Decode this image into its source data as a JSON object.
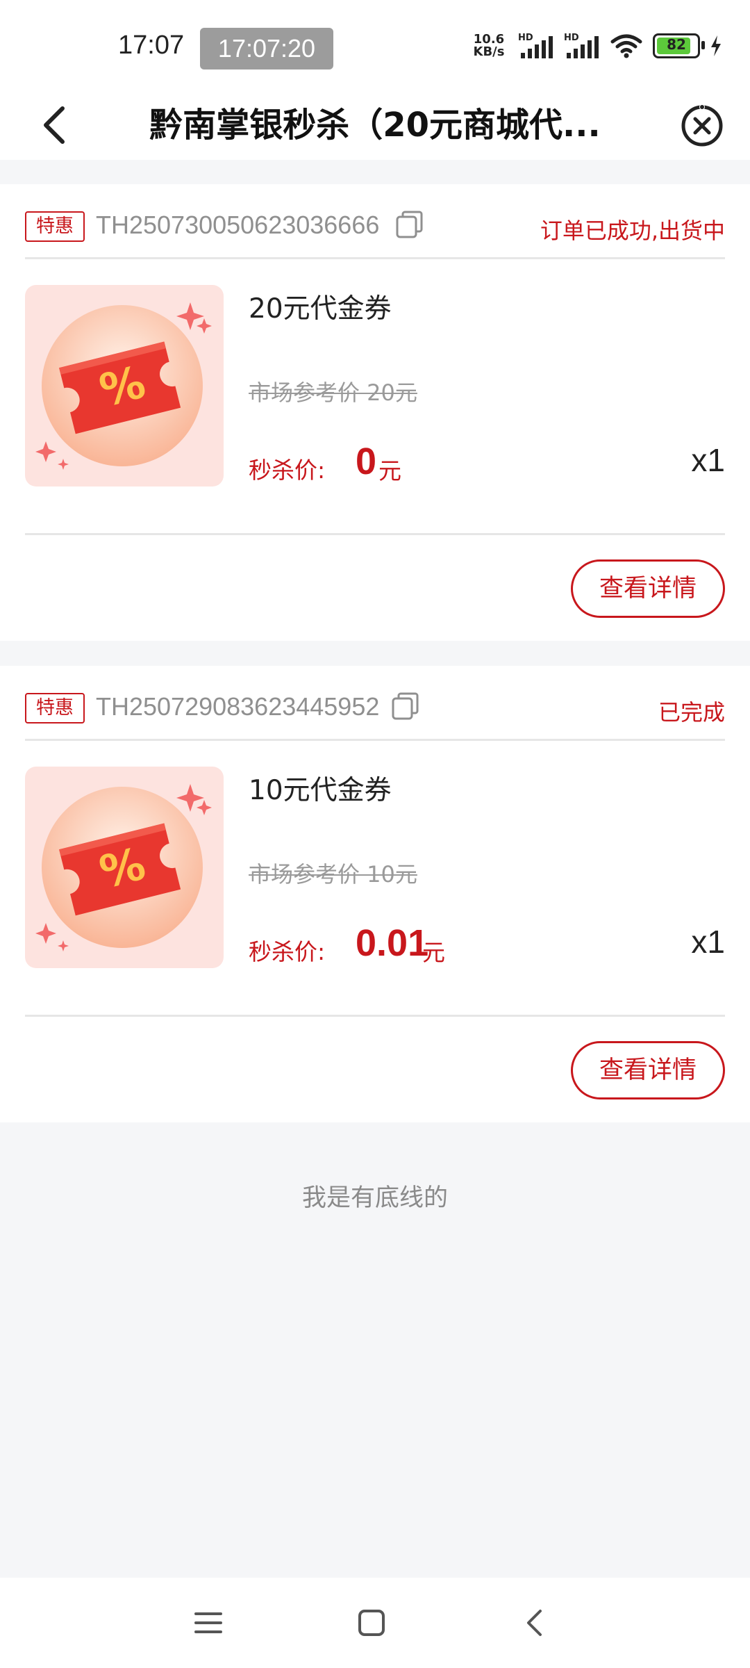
{
  "status_bar": {
    "time": "17:07",
    "time_badge": "17:07:20",
    "net_speed_value": "10.6",
    "net_speed_unit": "KB/s",
    "signal1_label": "HD",
    "signal2_label": "HD",
    "battery_level": "82"
  },
  "header": {
    "title": "黔南掌银秒杀（20元商城代..."
  },
  "orders": [
    {
      "tag": "特惠",
      "order_no": "TH250730050623036666",
      "status": "订单已成功,出货中",
      "product_name": "20元代金券",
      "market_price": "市场参考价 20元",
      "seckill_label": "秒杀价:",
      "seckill_price": "0",
      "price_unit": "元",
      "quantity": "x1",
      "detail_button": "查看详情"
    },
    {
      "tag": "特惠",
      "order_no": "TH250729083623445952",
      "status": "已完成",
      "product_name": "10元代金券",
      "market_price": "市场参考价 10元",
      "seckill_label": "秒杀价:",
      "seckill_price": "0.01",
      "price_unit": "元",
      "quantity": "x1",
      "detail_button": "查看详情"
    }
  ],
  "footer_note": "我是有底线的",
  "colors": {
    "accent": "#c8171c",
    "background": "#f5f6f8",
    "thumb_background": "#fde3df"
  }
}
